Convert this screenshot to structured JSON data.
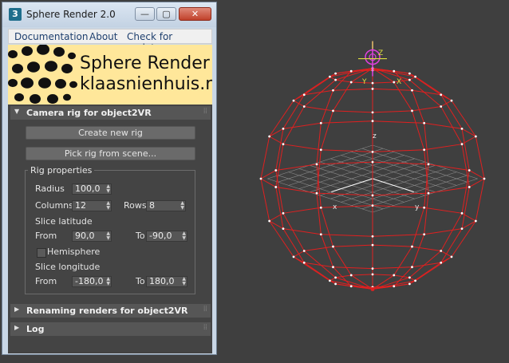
{
  "window": {
    "title": "Sphere Render 2.0",
    "icon_label": "3",
    "controls": {
      "minimize": "—",
      "maximize": "▢",
      "close": "✕"
    }
  },
  "menu": {
    "items": [
      "Documentation",
      "About",
      "Check for updates"
    ]
  },
  "banner": {
    "line1": "Sphere Render",
    "line2": "klaasnienhuis.nl"
  },
  "rollouts": {
    "camera": {
      "title": "Camera rig for object2VR",
      "create_button": "Create new rig",
      "pick_button": "Pick rig from scene...",
      "group_label": "Rig properties",
      "radius_label": "Radius",
      "radius_value": "100,0",
      "columns_label": "Columns",
      "columns_value": "12",
      "rows_label": "Rows",
      "rows_value": "8",
      "slice_lat_label": "Slice latitude",
      "lat_from_label": "From",
      "lat_from_value": "90,0",
      "lat_to_label": "To",
      "lat_to_value": "-90,0",
      "hemisphere_label": "Hemisphere",
      "slice_lon_label": "Slice longitude",
      "lon_from_label": "From",
      "lon_from_value": "-180,0",
      "lon_to_label": "To",
      "lon_to_value": "180,0"
    },
    "renaming": {
      "title": "Renaming renders for object2VR"
    },
    "log": {
      "title": "Log"
    }
  },
  "viewport": {
    "gizmo_labels": {
      "top_z": "Z",
      "y": "Y",
      "x": "X",
      "axis_x": "x",
      "axis_y": "y",
      "axis_z": "z"
    }
  },
  "colors": {
    "wireframe": "#e02020",
    "background": "#3f3f3f",
    "gizmo": "#e040e0"
  }
}
